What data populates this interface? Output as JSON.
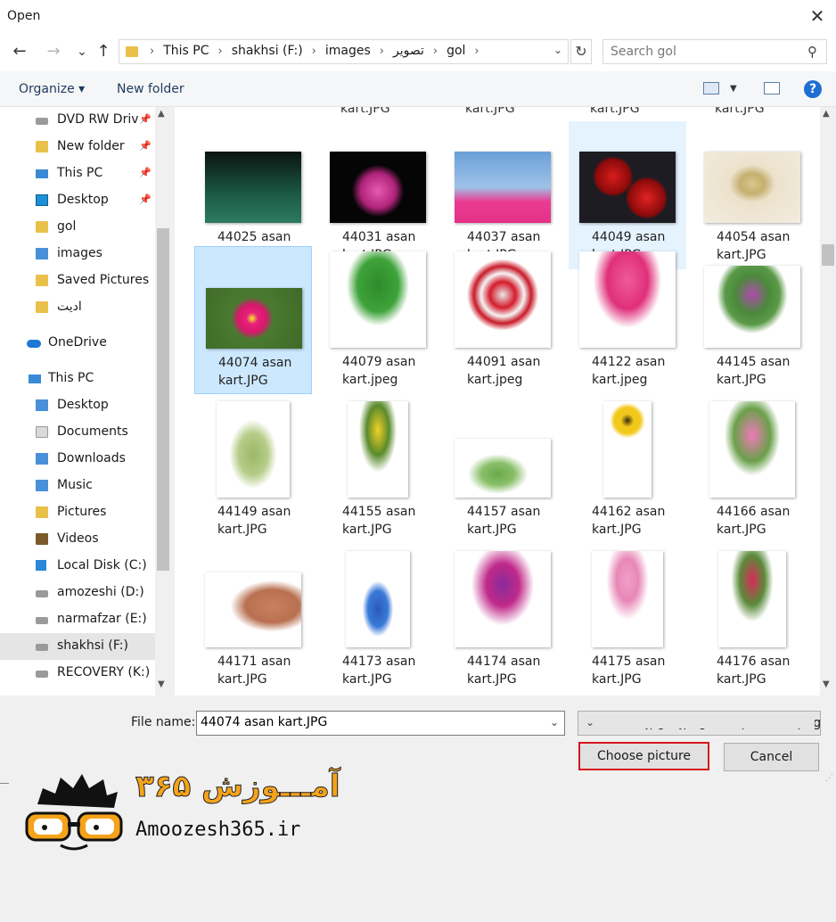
{
  "window": {
    "title": "Open",
    "close_glyph": "✕"
  },
  "nav": {
    "back": "←",
    "forward": "→",
    "recent": "⌄",
    "up": "↑",
    "breadcrumbs": [
      "This PC",
      "shakhsi (F:)",
      "images",
      "تصویر",
      "gol"
    ],
    "refresh": "↻",
    "search_placeholder": "Search gol"
  },
  "toolbar": {
    "organize": "Organize ▾",
    "new_folder": "New folder",
    "help": "?"
  },
  "sidebar": {
    "items": [
      {
        "label": "DVD RW Driv",
        "icon": "dvd-drive-icon",
        "pinned": true
      },
      {
        "label": "New folder",
        "icon": "folder-icon",
        "pinned": true
      },
      {
        "label": "This PC",
        "icon": "this-pc-icon",
        "pinned": true
      },
      {
        "label": "Desktop",
        "icon": "desktop-icon",
        "pinned": true
      },
      {
        "label": "gol",
        "icon": "folder-icon",
        "pinned": false
      },
      {
        "label": "images",
        "icon": "images-folder-icon",
        "pinned": false
      },
      {
        "label": "Saved Pictures",
        "icon": "folder-icon",
        "pinned": false
      },
      {
        "label": "ادیت",
        "icon": "folder-icon",
        "pinned": false
      },
      {
        "label": "OneDrive",
        "icon": "onedrive-icon",
        "pinned": false
      },
      {
        "label": "This PC",
        "icon": "this-pc-icon",
        "pinned": false
      },
      {
        "label": "Desktop",
        "icon": "desktop-folder-icon",
        "pinned": false
      },
      {
        "label": "Documents",
        "icon": "documents-icon",
        "pinned": false
      },
      {
        "label": "Downloads",
        "icon": "downloads-icon",
        "pinned": false
      },
      {
        "label": "Music",
        "icon": "music-icon",
        "pinned": false
      },
      {
        "label": "Pictures",
        "icon": "pictures-icon",
        "pinned": false
      },
      {
        "label": "Videos",
        "icon": "videos-icon",
        "pinned": false
      },
      {
        "label": "Local Disk (C:)",
        "icon": "windows-drive-icon",
        "pinned": false
      },
      {
        "label": "amozeshi (D:)",
        "icon": "drive-icon",
        "pinned": false
      },
      {
        "label": "narmafzar (E:)",
        "icon": "drive-icon",
        "pinned": false
      },
      {
        "label": "shakhsi (F:)",
        "icon": "drive-icon",
        "pinned": false,
        "selected": true
      },
      {
        "label": "RECOVERY (K:)",
        "icon": "drive-icon",
        "pinned": false
      }
    ]
  },
  "files": {
    "partial_label": "kart.JPG",
    "items": [
      {
        "name": "44025 asan kart.JPG",
        "state": ""
      },
      {
        "name": "44031 asan kart.JPG",
        "state": ""
      },
      {
        "name": "44037 asan kart.JPG",
        "state": ""
      },
      {
        "name": "44049 asan kart.JPG",
        "state": "hover"
      },
      {
        "name": "44054 asan kart.JPG",
        "state": ""
      },
      {
        "name": "44074 asan kart.JPG",
        "state": "selected"
      },
      {
        "name": "44079 asan kart.jpeg",
        "state": ""
      },
      {
        "name": "44091 asan kart.jpeg",
        "state": ""
      },
      {
        "name": "44122 asan kart.jpeg",
        "state": ""
      },
      {
        "name": "44145 asan kart.JPG",
        "state": ""
      },
      {
        "name": "44149 asan kart.JPG",
        "state": ""
      },
      {
        "name": "44155 asan kart.JPG",
        "state": ""
      },
      {
        "name": "44157 asan kart.JPG",
        "state": ""
      },
      {
        "name": "44162 asan kart.JPG",
        "state": ""
      },
      {
        "name": "44166 asan kart.JPG",
        "state": ""
      },
      {
        "name": "44171 asan kart.JPG",
        "state": ""
      },
      {
        "name": "44173 asan kart.JPG",
        "state": ""
      },
      {
        "name": "44174 asan kart.JPG",
        "state": ""
      },
      {
        "name": "44175 asan kart.JPG",
        "state": ""
      },
      {
        "name": "44176 asan kart.JPG",
        "state": ""
      }
    ]
  },
  "bottom": {
    "file_name_label": "File name:",
    "file_name_value": "44074 asan kart.JPG",
    "file_type": "All files (*.jpg;*.jpeg;*.bmp;*.dib;*.png",
    "choose_button": "Choose picture",
    "cancel_button": "Cancel"
  },
  "watermark": {
    "fa": "آمـــوزش ۳۶۵",
    "en": "Amoozesh365.ir"
  },
  "colors": {
    "selected_bg": "#cce8ff",
    "hover_bg": "#e5f3ff",
    "accent_red": "#d4151c",
    "logo_orange": "#f5a31a"
  }
}
